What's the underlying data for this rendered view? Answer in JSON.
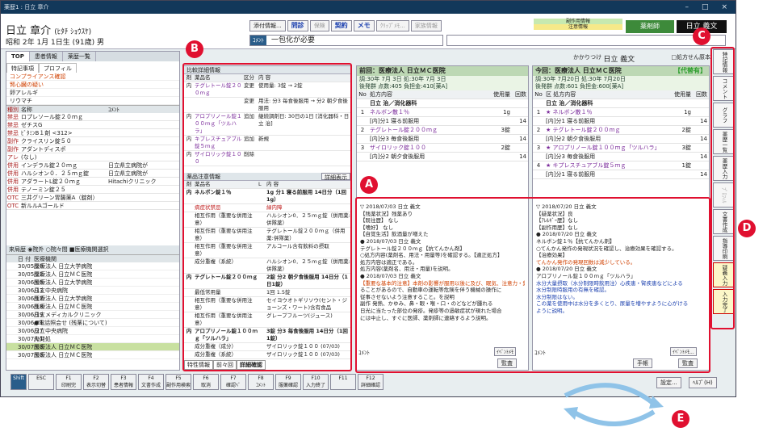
{
  "window": {
    "title": "薬歴1 : 日立 章介"
  },
  "patient": {
    "name": "日立 章介",
    "kana": "(ﾋﾀﾁ ｼｮｳｽｹ)",
    "birth": "昭和 2年 1月 1日生 (91歳) 男"
  },
  "toolbar": {
    "b1": "添付情報...",
    "b2": "問診",
    "b3": "保険",
    "b4": "契約",
    "b5": "メモ",
    "b6": "ｸﾘｯﾌﾟﾒﾓ...",
    "b7": "家族情報"
  },
  "flags": {
    "f1": "副作用情報",
    "f2": "注意情報"
  },
  "comment": {
    "label": "ｺﾒﾝﾄ",
    "value": "一包化が必要"
  },
  "pharmacist": {
    "label": "薬剤師",
    "value": "日立 義文"
  },
  "tabs": {
    "t1": "TOP",
    "t2": "患者情報",
    "t3": "薬歴一覧"
  },
  "subtabs": {
    "s1": "特記事項",
    "s2": "プロフィル"
  },
  "notices": [
    "コンプライアンス確認",
    "腎心臓の疑い",
    "卵アレルギ",
    "リウマチ"
  ],
  "druglist": {
    "h1": "種別",
    "h2": "名称",
    "h3": "ｺﾒﾝﾄ",
    "rows": [
      {
        "k": "禁忌",
        "n": "ロプレソール錠２０ｍｇ",
        "c": ""
      },
      {
        "k": "禁忌",
        "n": "ゼチスG",
        "c": ""
      },
      {
        "k": "禁忌",
        "n": "ﾋﾞﾀﾐﾝB１剤 <312>",
        "c": ""
      },
      {
        "k": "副作",
        "n": "クライスリン錠５０",
        "c": ""
      },
      {
        "k": "副作",
        "n": "アダントディスポ",
        "c": ""
      },
      {
        "k": "アレ",
        "n": "(なし)",
        "c": ""
      },
      {
        "k": "併用",
        "n": "インデラル錠２０ｍｇ",
        "c": "日立県立病院が"
      },
      {
        "k": "併用",
        "n": "ハルシオン０．２５ｍｇ錠",
        "c": "日立県立病院が"
      },
      {
        "k": "併用",
        "n": "アダラートL錠２０ｍｇ",
        "c": "Hitachiクリニック"
      },
      {
        "k": "併用",
        "n": "テノーミン錠２５",
        "c": ""
      },
      {
        "k": "OTC",
        "n": "三井グリーン胃腸薬A（錠剤）",
        "c": ""
      },
      {
        "k": "OTC",
        "n": "新ルルAゴールド",
        "c": ""
      }
    ]
  },
  "history": {
    "head": "来局歴",
    "opt1": "院外",
    "opt2": "院々間",
    "opt3": "医療機関選択",
    "h1": "日 付",
    "h2": "医療機関",
    "rows": [
      {
        "d": "30/05/20",
        "h": "医療法人 日立大学病院"
      },
      {
        "d": "30/05/22",
        "h": "医療法人 日立ＭＣ医院"
      },
      {
        "d": "30/06/05",
        "h": "医療法人 日立大学病院"
      },
      {
        "d": "30/06/13",
        "h": "日立中央病院"
      },
      {
        "d": "30/06/17",
        "h": "医療法人 日立大学病院"
      },
      {
        "d": "30/06/18",
        "h": "医療法人 日立ＭＣ医院"
      },
      {
        "d": "30/06/19",
        "h": "日立メディカルクリニック"
      },
      {
        "d": "30/06/21",
        "h": "●電話照会せ (残薬について)"
      },
      {
        "d": "30/06/27",
        "h": "日立中央病院"
      },
      {
        "d": "30/07/01",
        "h": "先発処"
      },
      {
        "d": "30/07/03",
        "h": "医療法人 日立ＭＣ医院",
        "sel": true
      },
      {
        "d": "30/07/03",
        "h": "医療法人 日立ＭＣ医院"
      }
    ]
  },
  "compare": {
    "title": "比較詳細情報",
    "h1": "剤",
    "h2": "薬品名",
    "h3": "区分",
    "h4": "内 容",
    "rows": [
      {
        "a": "内",
        "b": "テグレトール錠２００ｍｇ",
        "c": "変更",
        "d": "使用量: 3錠 → 2錠"
      },
      {
        "a": "",
        "b": "",
        "c": "変更",
        "d": "用法: 分3 毎食後服用 → 分2 朝夕食後服用"
      },
      {
        "a": "内",
        "b": "アロプリノール錠１００ｍｇ「ツルハラ」",
        "c": "追加",
        "d": "継続調剤日: 30日の1日 [消化器科・日立 治]"
      },
      {
        "a": "内",
        "b": "キプレスチュアブル錠５ｍｇ",
        "c": "追加",
        "d": "新規"
      },
      {
        "a": "内",
        "b": "ザイロリック錠１００",
        "c": "削除",
        "d": ""
      }
    ]
  },
  "interact": {
    "title": "薬品注意情報",
    "btn": "詳細表示",
    "h1": "剤",
    "h2": "薬品名",
    "h3": "L",
    "h4": "内 容",
    "rows": [
      {
        "a": "内",
        "b": "ネルボン錠１％",
        "c": "",
        "d": "1g 分1 寝る前服用 14日分（1回1g）",
        "bold": true
      },
      {
        "a": "",
        "b": "病症状禁忌",
        "c": "",
        "d": "緑内障"
      },
      {
        "a": "",
        "b": "相互作用（重要な併用注意）",
        "c": "",
        "d": "ハルシオン0．２５ｍｇ錠（併用薬:併隊薬）"
      },
      {
        "a": "",
        "b": "相互作用（重要な併用注意）",
        "c": "",
        "d": "テグレトール錠２００ｍｇ（併用薬:併隊薬）"
      },
      {
        "a": "",
        "b": "相互作用（重要な併用注意）",
        "c": "",
        "d": "アルコール含有飲料の摂取"
      },
      {
        "a": "",
        "b": "成分重複（系統）",
        "c": "",
        "d": "ハルシオン0．２５ｍｇ錠（併用薬:併隊薬）"
      },
      {
        "a": "内",
        "b": "テグレトール錠２００ｍｇ",
        "c": "",
        "d": "2錠 分2 朝夕食後服用 14日分（1日1錠）",
        "bold": true
      },
      {
        "a": "",
        "b": "最低常用量",
        "c": "",
        "d": "1回 1.5錠"
      },
      {
        "a": "",
        "b": "相互作用（重要な併用注意）",
        "c": "",
        "d": "セイヨウオトギリソウ(セント・ジョーンズ・ワート)含有食品"
      },
      {
        "a": "",
        "b": "相互作用（重要な併用注意）",
        "c": "",
        "d": "グレープフルーツ(ジュース)"
      },
      {
        "a": "内",
        "b": "アロプリノール錠１００ｍｇ「ツルハラ」",
        "c": "",
        "d": "3錠 分3 毎食後服用 14日分（1回1錠）",
        "bold": true
      },
      {
        "a": "",
        "b": "成分重複（成分）",
        "c": "",
        "d": "ザイロリック錠１００ (07/03)"
      },
      {
        "a": "",
        "b": "成分重複（系統）",
        "c": "",
        "d": "ザイロリック錠１００ (07/03)"
      }
    ]
  },
  "interact_tabs": {
    "t1": "特性情報",
    "t2": "前々回",
    "t3": "詳細確認"
  },
  "prev": {
    "title": "前回：医療法人 日立ＭＣ医院",
    "sub1": "調:30年 7月 3日 処:30年 7月 3日",
    "sub2": "後発群 点数:405 負担金:410[薬A]",
    "h1": "No",
    "h2": "処方内容",
    "h3": "使用量",
    "h4": "回数",
    "dept": "日立 治／消化器科",
    "rows": [
      {
        "n": "1",
        "nm": "ネルボン散１％",
        "q": "1g",
        "t": ""
      },
      {
        "n": "",
        "nm": "[内]分1 寝る前服用",
        "q": "",
        "t": "14"
      },
      {
        "n": "2",
        "nm": "テグレトール錠２００ｍｇ",
        "q": "3錠",
        "t": ""
      },
      {
        "n": "",
        "nm": "[内]分3 毎食後服用",
        "q": "",
        "t": "14"
      },
      {
        "n": "3",
        "nm": "ザイロリック錠１００",
        "q": "2錠",
        "t": ""
      },
      {
        "n": "",
        "nm": "[内]分2 朝夕食後服用",
        "q": "",
        "t": "14"
      }
    ],
    "notes": [
      "▽ 2018/07/03 日立 義文",
      "【残薬状況】残薬あり",
      "【既往歴】 なし",
      "【嗜好】 なし",
      "【自覚生活】飲酒量が増えた",
      "● 2018/07/03 日立 義文",
      "テグレトール錠２００ｍｇ【抗てんかん剤】",
      "○処方内容(薬剤名、用法・用量等)を確認する。【適正処方】",
      "処方内容は適正である。",
      "処方内容(薬剤名、用法・用量)を説明。",
      "● 2018/07/03 日立 義文",
      "【重要な基本的注意】本剤の影響が服用以後に及び、眠気、注意力・集中力・反射運動能力等の低下が起",
      "ることがあるので、自動車の運転等危険を伴う機械の操作に",
      "従事させないよう注意すること。を説明",
      "副作 発熱、かゆみ、鼻・眼・喉・口・のどなどが腫れる",
      "日光に当たった部位の発疹。発疹等の過敏症状が現れた場合",
      "には中止し、すぐに医師、薬剤師に連絡するよう説明。"
    ],
    "cmt": "ｺﾒﾝﾄ",
    "btn1": "ｲﾍﾞﾝﾄﾒﾓ",
    "btn2": "監査"
  },
  "current": {
    "title": "今回：医療法人 日立ＭＣ医院",
    "tag": "【代替有】",
    "sub1": "調:30年 7月20日 処:30年 7月20日",
    "sub2": "後発群 点数:601 負担金:600[薬A]",
    "h1": "No",
    "h2": "区 処方内容",
    "h3": "使用量",
    "h4": "回数",
    "dept": "日立 治／消化器科",
    "pharmacist_label": "かかりつけ",
    "pharmacist": "日立 義文",
    "check": "□処方せん原本",
    "rows": [
      {
        "n": "1",
        "nm": "★ ネルボン散１％",
        "q": "1g",
        "t": ""
      },
      {
        "n": "",
        "nm": "[内]分1 寝る前服用",
        "q": "",
        "t": "14"
      },
      {
        "n": "2",
        "nm": "★ テグレトール錠２００ｍｇ",
        "q": "2錠",
        "t": ""
      },
      {
        "n": "",
        "nm": "[内]分2 朝夕食後服用",
        "q": "",
        "t": "14"
      },
      {
        "n": "3",
        "nm": "★ アロプリノール錠１００ｍｇ「ツルハラ」",
        "q": "3錠",
        "t": ""
      },
      {
        "n": "",
        "nm": "[内]分3 毎食後服用",
        "q": "",
        "t": "14"
      },
      {
        "n": "4",
        "nm": "★ キプレスチュアブル錠５ｍｇ",
        "q": "1錠",
        "t": ""
      },
      {
        "n": "",
        "nm": "[内]分1 寝る前服用",
        "q": "",
        "t": "14"
      }
    ],
    "notes": [
      "▽ 2018/07/20 日立 義文",
      "【疑薬状況】良",
      "【ｱﾚﾙｷﾞｰ歴】なし",
      "【副作用歴】なし",
      "● 2018/07/20 日立 義文",
      "ネルボン錠１％【抗てんかん剤】",
      "○てんかん発作の発現状況を確認し、治療効果を確認する。",
      "【治療効果】",
      "てんかん発作の発現回数は減少している。",
      "● 2018/07/20 日立 義文",
      "アロプリノール錠１００ｍｇ「ツルハラ」",
      "水分大量摂取（水分制限時飲用注）心疾患・腎疾患などによる",
      "水分制限時服用の有無を確認。",
      "水分制限はない。",
      "この薬を使用中は水分を多くとり、尿量を増やすように心がける",
      "ように説明。"
    ],
    "cmt": "ｺﾒﾝﾄ",
    "btn1": "ｲﾍﾞﾝﾄﾒﾓ...",
    "btn2": "手帳",
    "btn3": "監査"
  },
  "vtabs": [
    "特記情報",
    "コメント",
    "グラフ",
    "薬歴一覧",
    "薬歴入力",
    "ﾌﾟﾛﾌｨﾙ",
    "文書作成",
    "指導印刷",
    "疑義入力",
    "入力完了"
  ],
  "fkeys": [
    {
      "k": "Shift",
      "l": ""
    },
    {
      "k": "ESC",
      "l": ""
    },
    {
      "k": "F1",
      "l": "印刷完"
    },
    {
      "k": "F2",
      "l": "表示切替"
    },
    {
      "k": "F3",
      "l": "患者情報"
    },
    {
      "k": "F4",
      "l": "文書作成"
    },
    {
      "k": "F5",
      "l": "副作用検索"
    },
    {
      "k": "F6",
      "l": "取消"
    },
    {
      "k": "F7",
      "l": "確認ﾍﾞ"
    },
    {
      "k": "F8",
      "l": "ｺﾒﾝﾄ"
    },
    {
      "k": "F9",
      "l": "服薬確認"
    },
    {
      "k": "F10",
      "l": "入力終了"
    },
    {
      "k": "F11",
      "l": ""
    },
    {
      "k": "F12",
      "l": "詳細確認"
    }
  ],
  "footer": {
    "settings": "設定...",
    "help": "ﾍﾙﾌﾟ(H)"
  },
  "callouts": {
    "A": "A",
    "B": "B",
    "C": "C",
    "D": "D",
    "E": "E"
  },
  "colors": {
    "callout": "#e01030",
    "hist_selected": "#c8e0a0",
    "rx_header": "#bdd8b4"
  }
}
